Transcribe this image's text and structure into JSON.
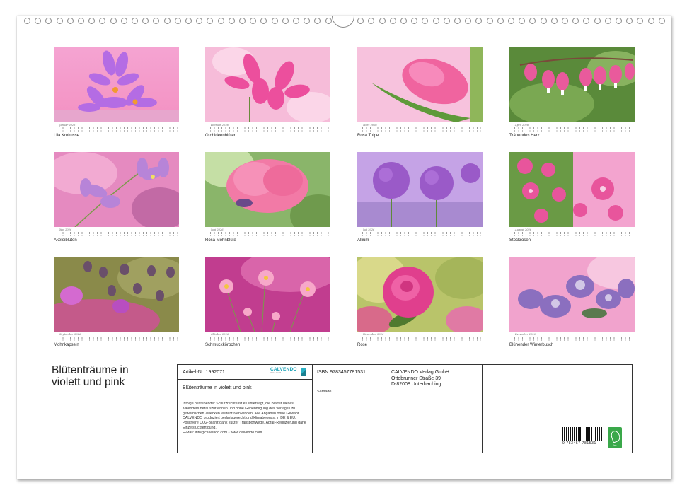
{
  "calendar": {
    "title_line1": "Blütenträume in",
    "title_line2": "violett und pink",
    "months": [
      {
        "month": "Januar 2026",
        "caption": "Lila Krokusse"
      },
      {
        "month": "Februar 2026",
        "caption": "Orchideenblüten"
      },
      {
        "month": "März 2026",
        "caption": "Rosa Tulpe"
      },
      {
        "month": "April 2026",
        "caption": "Tränendes Herz"
      },
      {
        "month": "Mai 2026",
        "caption": "Akeleiblüten"
      },
      {
        "month": "Juni 2026",
        "caption": "Rosa Mohnblüte"
      },
      {
        "month": "Juli 2026",
        "caption": "Allium"
      },
      {
        "month": "August 2026",
        "caption": "Stockrosen"
      },
      {
        "month": "September 2026",
        "caption": "Mohnkapseln"
      },
      {
        "month": "Oktober 2026",
        "caption": "Schmuckkörbchen"
      },
      {
        "month": "November 2026",
        "caption": "Rose"
      },
      {
        "month": "Dezember 2026",
        "caption": "Blühender Winterbusch"
      }
    ]
  },
  "info": {
    "article": "Artikel-Nr. 1992071",
    "logo_text": "CALVENDO",
    "logo_sub": "Verlag GmbH",
    "product_title": "Blütenträume in violett und pink",
    "legal": "Infolge bestehender Schutzrechte ist es untersagt, die Blätter dieses Kalenders herauszutrennen und ohne Genehmigung des Verlages zu gewerblichen Zwecken weiterzuverwenden. Alle Angaben ohne Gewähr. CALVENDO produziert bedarfsgerecht und klimabewusst in DE & EU. Positivere CO2-Bilanz dank kurzer Transportwege. Abfall-Reduzierung dank Einzelstückfertigung.",
    "email": "E-Mail: info@calvendo.com • www.calvendo.com",
    "isbn": "ISBN 9783457781531",
    "publisher_name": "CALVENDO Verlag GmbH",
    "publisher_street": "Ottobrunner Straße 39",
    "publisher_city": "D-82008 Unterhaching",
    "author": "Samade",
    "barcode_number": "9 783457 781531",
    "fsc_label": "fsc"
  },
  "colors": {
    "pink": "#f07ab8",
    "violet": "#a974d8",
    "green": "#6fa050"
  }
}
